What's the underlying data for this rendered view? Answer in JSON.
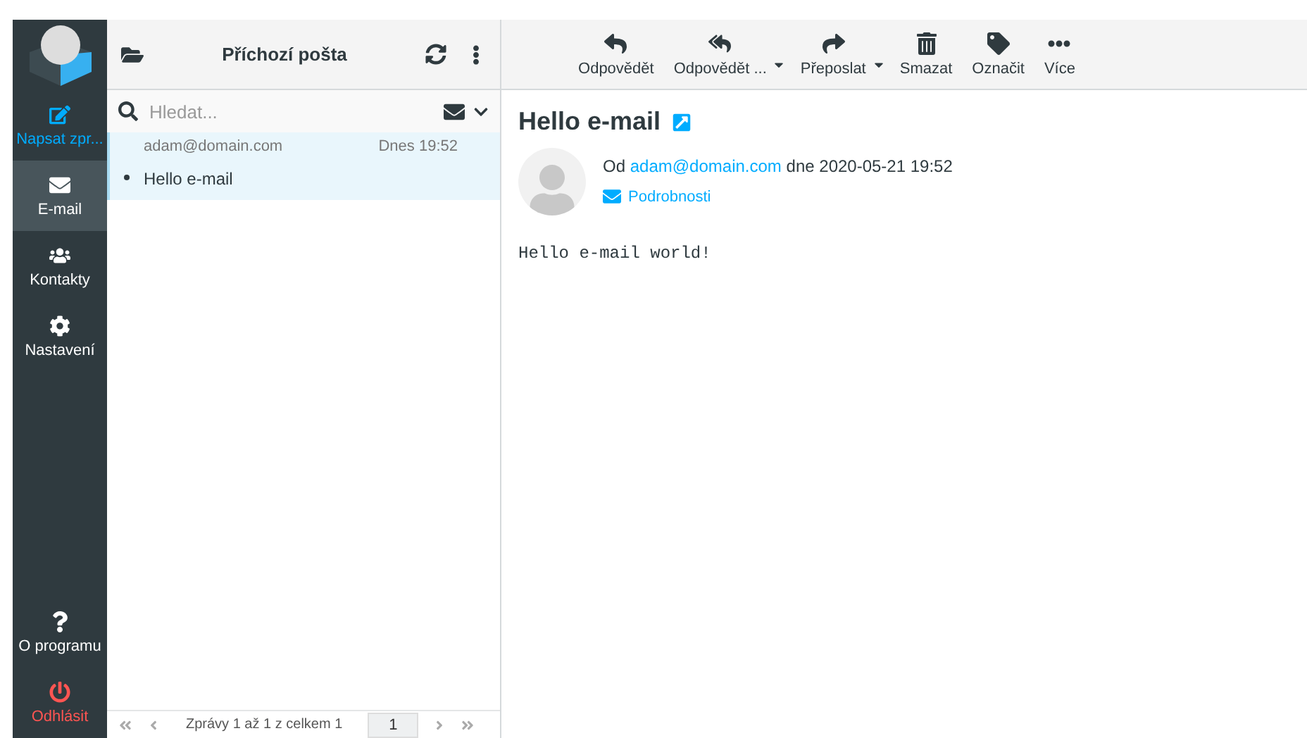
{
  "sidebar": {
    "items": [
      {
        "kind": "compose",
        "label": "Napsat zpr...",
        "selected": false
      },
      {
        "kind": "mail",
        "label": "E-mail",
        "selected": true
      },
      {
        "kind": "contacts",
        "label": "Kontakty",
        "selected": false
      },
      {
        "kind": "settings",
        "label": "Nastavení",
        "selected": false
      }
    ],
    "bottom_items": [
      {
        "kind": "about",
        "label": "O programu",
        "selected": false
      },
      {
        "kind": "logout",
        "label": "Odhlásit",
        "selected": false
      }
    ]
  },
  "folder": {
    "title": "Příchozí pošta"
  },
  "search": {
    "placeholder": "Hledat..."
  },
  "messages": [
    {
      "from": "adam@domain.com",
      "date": "Dnes 19:52",
      "subject": "Hello e-mail",
      "unread": true,
      "selected": true
    }
  ],
  "pagination": {
    "text": "Zprávy 1 až 1 z celkem 1",
    "page": "1"
  },
  "toolbar": [
    {
      "kind": "reply",
      "label": "Odpovědět",
      "dropdown": false
    },
    {
      "kind": "reply-all",
      "label": "Odpovědět ...",
      "dropdown": true
    },
    {
      "kind": "forward",
      "label": "Přeposlat",
      "dropdown": true
    },
    {
      "kind": "delete",
      "label": "Smazat",
      "dropdown": false
    },
    {
      "kind": "tag",
      "label": "Označit",
      "dropdown": false
    },
    {
      "kind": "more",
      "label": "Více",
      "dropdown": false
    }
  ],
  "message": {
    "subject": "Hello e-mail",
    "from_prefix": "Od",
    "from": "adam@domain.com",
    "date_prefix": "dne",
    "date": "2020-05-21 19:52",
    "details": "Podrobnosti",
    "body": "Hello e-mail world!"
  }
}
